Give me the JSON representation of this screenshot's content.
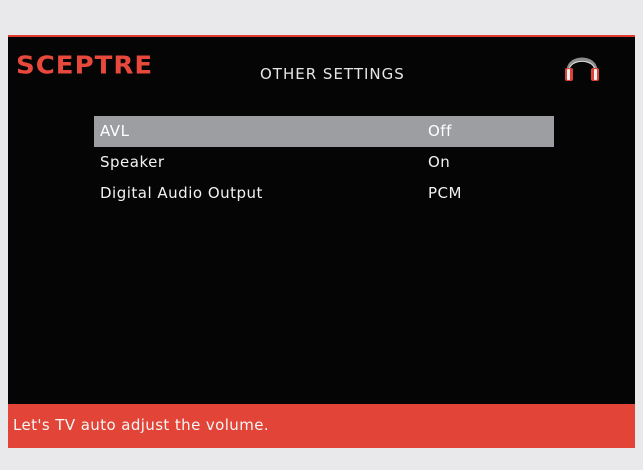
{
  "brand": {
    "logo": "SCEPTRE"
  },
  "header": {
    "title": "OTHER SETTINGS",
    "icon": "headphone-icon"
  },
  "menu": {
    "items": [
      {
        "label": "AVL",
        "value": "Off",
        "selected": true
      },
      {
        "label": "Speaker",
        "value": "On",
        "selected": false
      },
      {
        "label": "Digital Audio Output",
        "value": "PCM",
        "selected": false
      }
    ]
  },
  "help": {
    "text": "Let's TV auto adjust the volume."
  },
  "colors": {
    "brand_red": "#e8493c",
    "highlight": "#9c9ea1",
    "background": "#050505"
  }
}
